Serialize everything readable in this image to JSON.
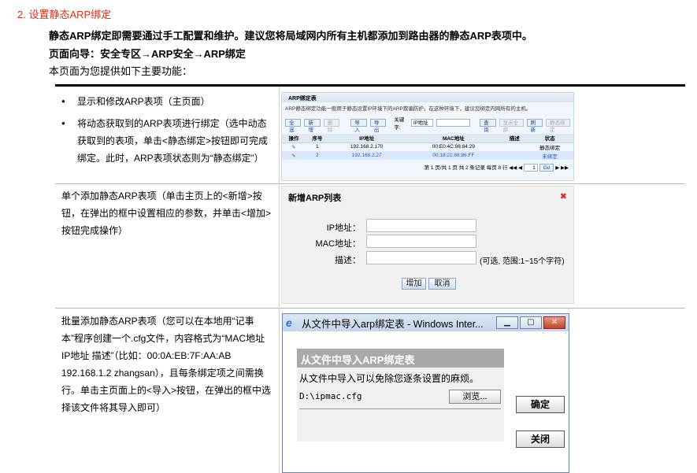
{
  "section": {
    "title": "2. 设置静态ARP绑定",
    "intro": "静态ARP绑定即需要通过手工配置和维护。建议您将局域网内所有主机都添加到路由器的静态ARP表项中。",
    "nav": "页面向导：安全专区→ARP安全→ARP绑定",
    "lead": "本页面为您提供如下主要功能："
  },
  "row1": {
    "bullets": [
      "显示和修改ARP表项（主页面）",
      "将动态获取到的ARP表项进行绑定（选中动态获取到的表项，单击<静态绑定>按钮即可完成绑定。此时，ARP表项状态则为“静态绑定”）"
    ],
    "shot": {
      "title": "ARP绑定表",
      "note": "ARP静态绑定功能一般用于静态设置IP环境下的ARP欺骗防护，在这种环境下，建议您绑定内网所有的主机。",
      "toolbar": [
        "全选",
        "新增",
        "删除",
        "导入",
        "导出"
      ],
      "keyword_label": "关键字:",
      "keyword_value": "IP地址",
      "right_buttons": [
        "查询",
        "显示全部",
        "刷新",
        "静态绑定"
      ],
      "columns": [
        "操作",
        "序号",
        "IP地址",
        "MAC地址",
        "描述",
        "状态"
      ],
      "rows": [
        {
          "no": "1",
          "ip": "192.168.2.170",
          "mac": "00:E0:4C:98:84:29",
          "desc": "",
          "status": "静态绑定"
        },
        {
          "no": "2",
          "ip": "192.168.2.27",
          "mac": "00:18:21:88:86:FF",
          "desc": "",
          "status": "未绑定"
        }
      ],
      "pager": "第 1 页/共 1 页 共 2 条记录 每页 8 行",
      "page_input": "1",
      "go_label": "Go"
    }
  },
  "row2": {
    "desc": "单个添加静态ARP表项（单击主页上的<新增>按钮，在弹出的框中设置相应的参数，并单击<增加>按钮完成操作）",
    "dialog": {
      "title": "新增ARP列表",
      "ip_label": "IP地址：",
      "mac_label": "MAC地址：",
      "desc_label": "描述：",
      "desc_hint": "(可选, 范围:1~15个字符)",
      "add_label": "增加",
      "cancel_label": "取消"
    }
  },
  "row3": {
    "desc": "批量添加静态ARP表项（您可以在本地用“记事本”程序创建一个.cfg文件，内容格式为“MAC地址 IP地址 描述”（比如：00:0A:EB:7F:AA:AB 192.168.1.2 zhangsan），且每条绑定项之间需换行。单击主页面上的<导入>按钮，在弹出的框中选择该文件将其导入即可）",
    "window": {
      "title": "从文件中导入arp绑定表 - Windows Inter...",
      "panel_title": "从文件中导入ARP绑定表",
      "panel_desc": "从文件中导入可以免除您逐条设置的麻烦。",
      "file_path": "D:\\ipmac.cfg",
      "browse_label": "浏览...",
      "ok_label": "确定",
      "close_label": "关闭"
    }
  },
  "colors": {
    "title": "#d8301b",
    "link_blue": "#2855c8"
  }
}
